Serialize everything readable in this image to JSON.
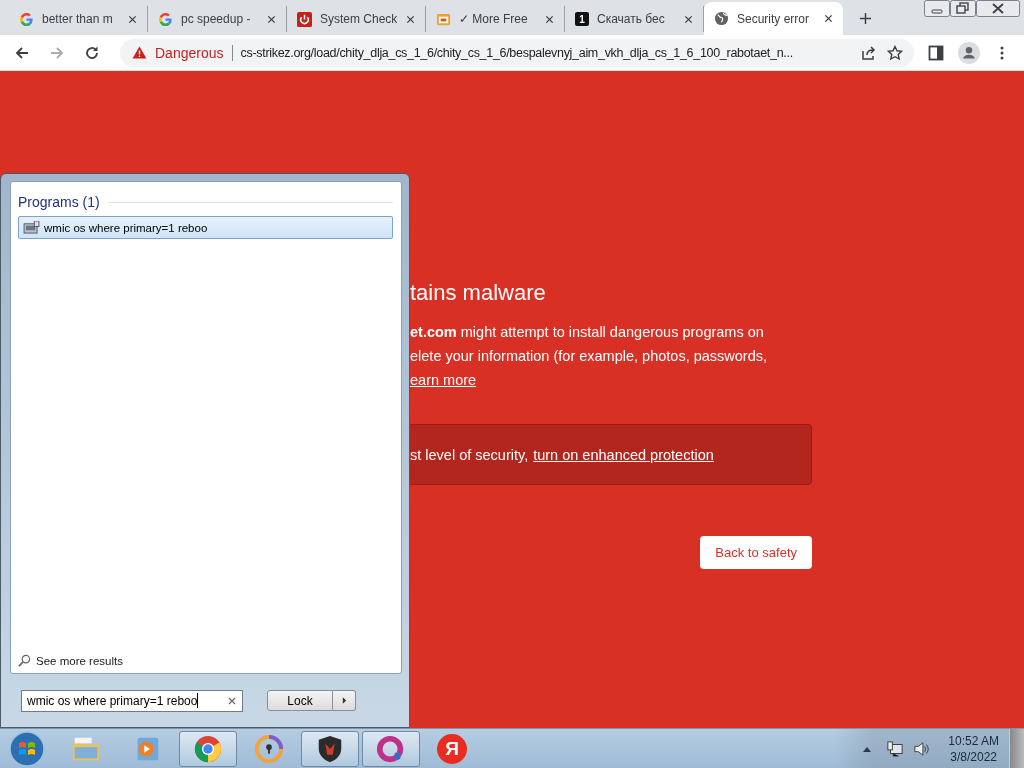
{
  "browser": {
    "tabs": [
      {
        "kind": "google",
        "title": "better than m",
        "selected": false
      },
      {
        "kind": "google",
        "title": "pc speedup -",
        "selected": false
      },
      {
        "kind": "power",
        "title": "System Check",
        "selected": false
      },
      {
        "kind": "tool",
        "title": "✓ More Free",
        "selected": false
      },
      {
        "kind": "number",
        "badge": "1",
        "title": "Скачать бес",
        "selected": false
      },
      {
        "kind": "globe",
        "title": "Security error",
        "selected": true
      }
    ],
    "toolbar": {
      "security_label": "Dangerous",
      "url": "cs-strikez.org/load/chity_dlja_cs_1_6/chity_cs_1_6/bespalevnyj_aim_vkh_dlja_cs_1_6_100_rabotaet_n..."
    }
  },
  "page": {
    "heading": "tains malware",
    "paragraph_lines": [
      "**et.com** might attempt to install dangerous programs on",
      "elete your information (for example, photos, passwords,"
    ],
    "learn_more": "earn more",
    "protection_text": "st level of security,",
    "protection_link": "turn on enhanced protection",
    "back_button": "Back to safety"
  },
  "start_menu": {
    "section": "Programs (1)",
    "results": [
      {
        "label": "wmic os where primary=1 reboo",
        "selected": true
      }
    ],
    "see_more": "See more results",
    "search_value": "wmic os where primary=1 reboo",
    "power_button": "Lock"
  },
  "taskbar": {
    "apps": [
      {
        "kind": "explorer",
        "running": false
      },
      {
        "kind": "media",
        "running": false
      },
      {
        "kind": "chrome",
        "running": true
      },
      {
        "kind": "vpn",
        "running": false
      },
      {
        "kind": "shield",
        "running": true
      },
      {
        "kind": "ring",
        "running": true
      },
      {
        "kind": "yandex",
        "label": "Я",
        "running": false
      }
    ],
    "clock": {
      "time": "10:52 AM",
      "date": "3/8/2022"
    }
  }
}
